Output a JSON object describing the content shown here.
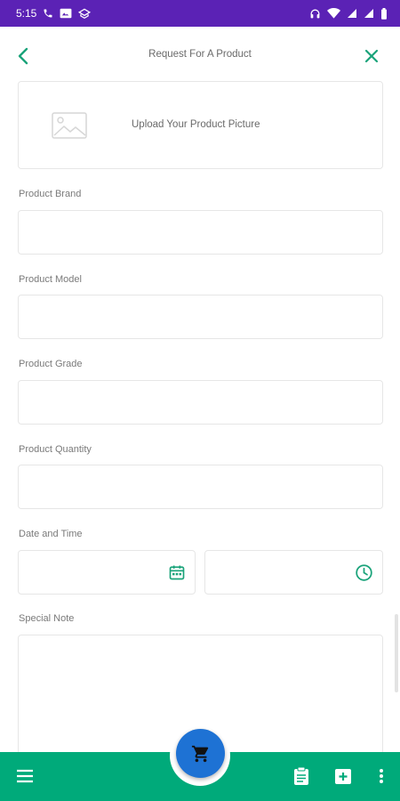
{
  "status_bar": {
    "time": "5:15",
    "background": "#5b22b5"
  },
  "header": {
    "title": "Request For A Product",
    "accent": "#1aa37a"
  },
  "upload": {
    "label": "Upload Your Product Picture",
    "icon": "image-placeholder-icon"
  },
  "form": {
    "brand": {
      "label": "Product Brand",
      "value": ""
    },
    "model": {
      "label": "Product Model",
      "value": ""
    },
    "grade": {
      "label": "Product Grade",
      "value": ""
    },
    "quantity": {
      "label": "Product Quantity",
      "value": ""
    },
    "datetime": {
      "label": "Date and Time",
      "date_value": "",
      "time_value": ""
    },
    "note": {
      "label": "Special Note",
      "value": ""
    }
  },
  "bottom_nav": {
    "background": "#00aa7a",
    "fab_color": "#1e72d4",
    "items": [
      "menu-icon",
      "cart-icon",
      "clipboard-icon",
      "add-box-icon",
      "more-vert-icon"
    ]
  }
}
